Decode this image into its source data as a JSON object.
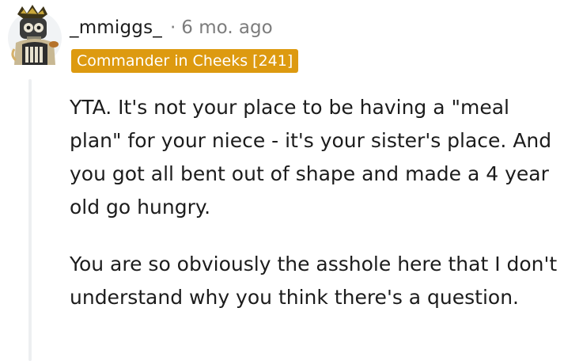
{
  "comment": {
    "username": "_mmiggs_",
    "separator": "·",
    "timestamp": "6 mo. ago",
    "flair": "Commander in Cheeks [241]",
    "paragraphs": [
      "YTA. It's not your place to be having a \"meal plan\" for your niece - it's your sister's place. And you got all bent out of shape and made a 4 year old go hungry.",
      "You are so obviously the asshole here that I don't understand why you think there's a question."
    ]
  },
  "colors": {
    "flair_background": "#dd9a10",
    "flair_text": "#ffffff",
    "meta_text": "#7c7c7c",
    "body_text": "#1c1c1c",
    "thread_line": "#edeff1"
  },
  "icons": {
    "avatar": "skeleton-avatar-icon"
  }
}
